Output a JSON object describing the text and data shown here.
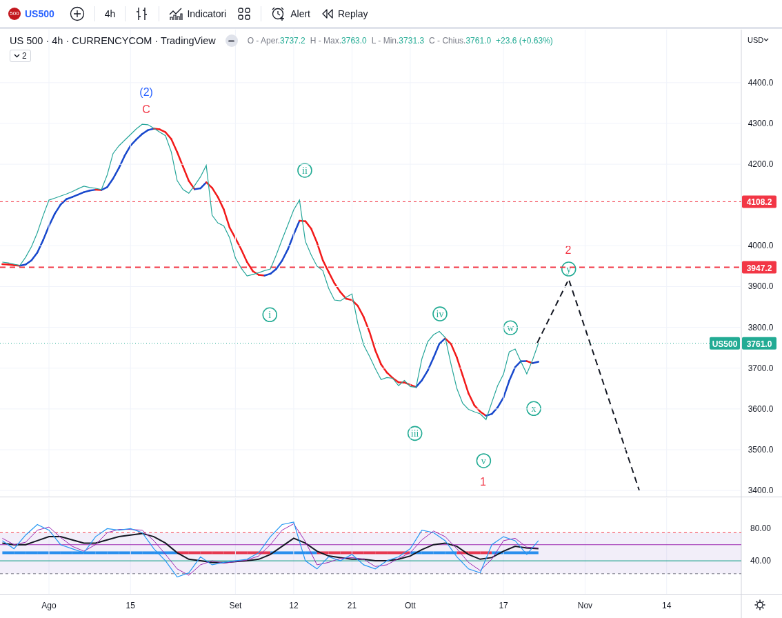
{
  "toolbar": {
    "symbol_badge": "500",
    "symbol": "US500",
    "interval": "4h",
    "buttons": [
      {
        "kind": "indicators",
        "label": "Indicatori"
      },
      {
        "kind": "layouts"
      },
      {
        "kind": "alert",
        "label": "Alert"
      },
      {
        "kind": "replay",
        "label": "Replay"
      }
    ]
  },
  "legend": {
    "title": "US 500 · 4h · CURRENCYCOM · TradingView",
    "ohlc": [
      {
        "label": "O - Aper.",
        "value": "3737.2"
      },
      {
        "label": "H - Max.",
        "value": "3763.0"
      },
      {
        "label": "L - Min.",
        "value": "3731.3"
      },
      {
        "label": "C - Chius.",
        "value": "3761.0"
      }
    ],
    "change": "+23.6 (+0.63%)",
    "collapsed_count": "2"
  },
  "price_axis": {
    "currency": "USD"
  },
  "main_chart": {
    "chart_data": {
      "type": "line",
      "grid": true,
      "ylim": [
        3385,
        4530
      ],
      "yticks": [
        {
          "value": 4400,
          "label": "4400.0"
        },
        {
          "value": 4300,
          "label": "4300.0"
        },
        {
          "value": 4200,
          "label": "4200.0"
        },
        {
          "value": 4000,
          "label": "4000.0"
        },
        {
          "value": 3900,
          "label": "3900.0"
        },
        {
          "value": 3800,
          "label": "3800.0"
        },
        {
          "value": 3700,
          "label": "3700.0"
        },
        {
          "value": 3600,
          "label": "3600.0"
        },
        {
          "value": 3500,
          "label": "3500.0"
        },
        {
          "value": 3400,
          "label": "3400.0"
        }
      ],
      "categories": [
        null,
        null,
        null,
        null,
        null,
        null,
        null,
        null,
        null,
        null,
        null,
        null,
        null,
        null,
        null,
        null,
        null,
        null,
        null,
        null,
        null,
        null,
        null,
        null,
        null,
        null,
        null,
        null,
        null,
        null,
        null,
        null,
        null,
        null,
        null,
        null,
        null,
        null,
        null,
        null,
        null,
        null,
        null,
        null,
        null,
        null,
        null,
        null,
        null,
        null,
        null,
        null,
        null,
        null,
        null,
        null,
        null,
        null,
        null,
        null,
        null,
        null,
        null,
        null,
        null,
        null,
        null,
        null,
        null,
        null,
        null,
        null,
        null,
        null,
        null,
        null,
        null,
        null,
        null,
        null,
        null,
        null,
        null,
        null,
        null,
        null,
        null,
        null,
        null,
        null,
        null,
        null,
        null,
        null,
        null,
        null,
        null,
        null,
        null,
        null,
        null,
        null,
        null,
        null,
        null,
        null,
        null,
        null,
        null,
        null,
        null,
        null,
        null,
        null,
        null,
        null,
        null,
        null,
        null,
        null,
        null,
        null,
        null,
        null,
        null,
        null
      ],
      "series": [
        {
          "name": "US500",
          "color": "#26a69a",
          "values": [
            3960,
            3958,
            3955,
            3952,
            3972,
            3998,
            4032,
            4074,
            4112,
            4117,
            4122,
            4127,
            4133,
            4140,
            4146,
            4143,
            4141,
            4138,
            4174,
            4226,
            4245,
            4259,
            4273,
            4287,
            4298,
            4297,
            4288,
            4279,
            4270,
            4230,
            4160,
            4138,
            4129,
            4148,
            4169,
            4197,
            4075,
            4056,
            4049,
            4020,
            3970,
            3945,
            3926,
            3930,
            3934,
            3939,
            3943,
            3977,
            4015,
            4051,
            4088,
            4112,
            4011,
            3978,
            3950,
            3939,
            3896,
            3867,
            3865,
            3874,
            3882,
            3810,
            3757,
            3729,
            3699,
            3672,
            3677,
            3675,
            3657,
            3670,
            3655,
            3653,
            3723,
            3765,
            3782,
            3790,
            3775,
            3710,
            3650,
            3614,
            3599,
            3593,
            3588,
            3574,
            3616,
            3657,
            3685,
            3740,
            3747,
            3716,
            3686,
            3720,
            3761,
            null,
            null,
            null,
            null,
            null,
            null,
            null,
            null,
            null,
            null,
            null,
            null,
            null,
            null,
            null,
            null,
            null,
            null,
            null,
            null,
            null,
            null,
            null,
            null,
            null,
            null,
            null,
            null,
            null,
            null,
            null,
            null,
            null
          ]
        }
      ],
      "ref_lines": [
        {
          "axis": "y",
          "value": 4108.2,
          "label": "4108.2",
          "color": "#f23645"
        },
        {
          "axis": "y",
          "value": 3947.2,
          "label": "3947.2",
          "color": "#f23645"
        },
        {
          "axis": "y",
          "value": 3761.0,
          "label": "3761.0",
          "color": "#22ab94"
        }
      ]
    }
  },
  "wave_labels": [
    {
      "text": "(2)",
      "color": "#2962ff",
      "circled": false
    },
    {
      "text": "C",
      "color": "#f23645",
      "circled": false
    },
    {
      "text": "ii",
      "color": "#22ab94",
      "circled": true
    },
    {
      "text": "i",
      "color": "#22ab94",
      "circled": true
    },
    {
      "text": "iii",
      "color": "#22ab94",
      "circled": true
    },
    {
      "text": "iv",
      "color": "#22ab94",
      "circled": true
    },
    {
      "text": "v",
      "color": "#22ab94",
      "circled": true
    },
    {
      "text": "1",
      "color": "#f23645",
      "circled": false
    },
    {
      "text": "w",
      "color": "#22ab94",
      "circled": true
    },
    {
      "text": "x",
      "color": "#22ab94",
      "circled": true
    },
    {
      "text": "y",
      "color": "#22ab94",
      "circled": true
    },
    {
      "text": "2",
      "color": "#f23645",
      "circled": false
    }
  ],
  "indicator": {
    "chart_data": {
      "type": "line",
      "grid": true,
      "ylim": [
        -1,
        118
      ],
      "yticks": [
        {
          "value": 80,
          "label": "80.00"
        },
        {
          "value": 40,
          "label": "40.00"
        }
      ],
      "categories": [
        null,
        null,
        null,
        null,
        "Ago",
        null,
        null,
        null,
        null,
        null,
        null,
        "15",
        null,
        null,
        null,
        null,
        null,
        null,
        null,
        null,
        "Set",
        null,
        null,
        null,
        null,
        "12",
        null,
        null,
        null,
        null,
        "21",
        null,
        null,
        null,
        null,
        "Ott",
        null,
        null,
        null,
        null,
        null,
        null,
        null,
        "17",
        null,
        null,
        null,
        null,
        null,
        null,
        "Nov",
        null,
        null,
        null,
        null,
        null,
        null,
        "14",
        null,
        null,
        null,
        null,
        null
      ],
      "series": [
        {
          "color": "#2196f3",
          "values": [
            65,
            55,
            72,
            85,
            78,
            60,
            55,
            50,
            70,
            80,
            78,
            80,
            75,
            55,
            40,
            20,
            25,
            45,
            35,
            38,
            40,
            42,
            50,
            70,
            85,
            88,
            40,
            30,
            45,
            40,
            48,
            35,
            30,
            40,
            45,
            55,
            78,
            75,
            65,
            45,
            30,
            25,
            60,
            70,
            65,
            48,
            65,
            null,
            null,
            null,
            null,
            null,
            null,
            null,
            null,
            null,
            null,
            null,
            null,
            null,
            null,
            null,
            null
          ]
        },
        {
          "color": "#9c27b0",
          "values": [
            68,
            60,
            63,
            78,
            82,
            69,
            58,
            52,
            60,
            75,
            79,
            79,
            78,
            65,
            48,
            30,
            22,
            35,
            40,
            37,
            39,
            41,
            46,
            60,
            78,
            86,
            64,
            35,
            38,
            43,
            44,
            42,
            33,
            35,
            43,
            50,
            66,
            77,
            70,
            55,
            38,
            28,
            42,
            65,
            68,
            57,
            56,
            null,
            null,
            null,
            null,
            null,
            null,
            null,
            null,
            null,
            null,
            null,
            null,
            null,
            null,
            null,
            null
          ]
        },
        {
          "color": "#131722",
          "values": [
            62,
            60,
            60,
            65,
            70,
            70,
            66,
            62,
            62,
            66,
            70,
            72,
            74,
            70,
            62,
            50,
            42,
            40,
            38,
            38,
            39,
            40,
            42,
            48,
            58,
            68,
            62,
            52,
            46,
            44,
            42,
            42,
            40,
            40,
            42,
            46,
            54,
            60,
            62,
            58,
            48,
            42,
            44,
            52,
            58,
            56,
            55,
            null,
            null,
            null,
            null,
            null,
            null,
            null,
            null,
            null,
            null,
            null,
            null,
            null,
            null,
            null,
            null
          ]
        }
      ],
      "bands": [
        {
          "axis": "y",
          "from": 24,
          "to": 75,
          "color": "#7e57c2"
        }
      ],
      "ref_lines": [
        {
          "axis": "y",
          "value": 75,
          "color": "#f23645"
        },
        {
          "axis": "y",
          "value": 60,
          "color": "#9c27b0"
        },
        {
          "axis": "y",
          "value": 40,
          "color": "#089981"
        },
        {
          "axis": "y",
          "value": 24,
          "color": "#787b86"
        }
      ]
    }
  }
}
